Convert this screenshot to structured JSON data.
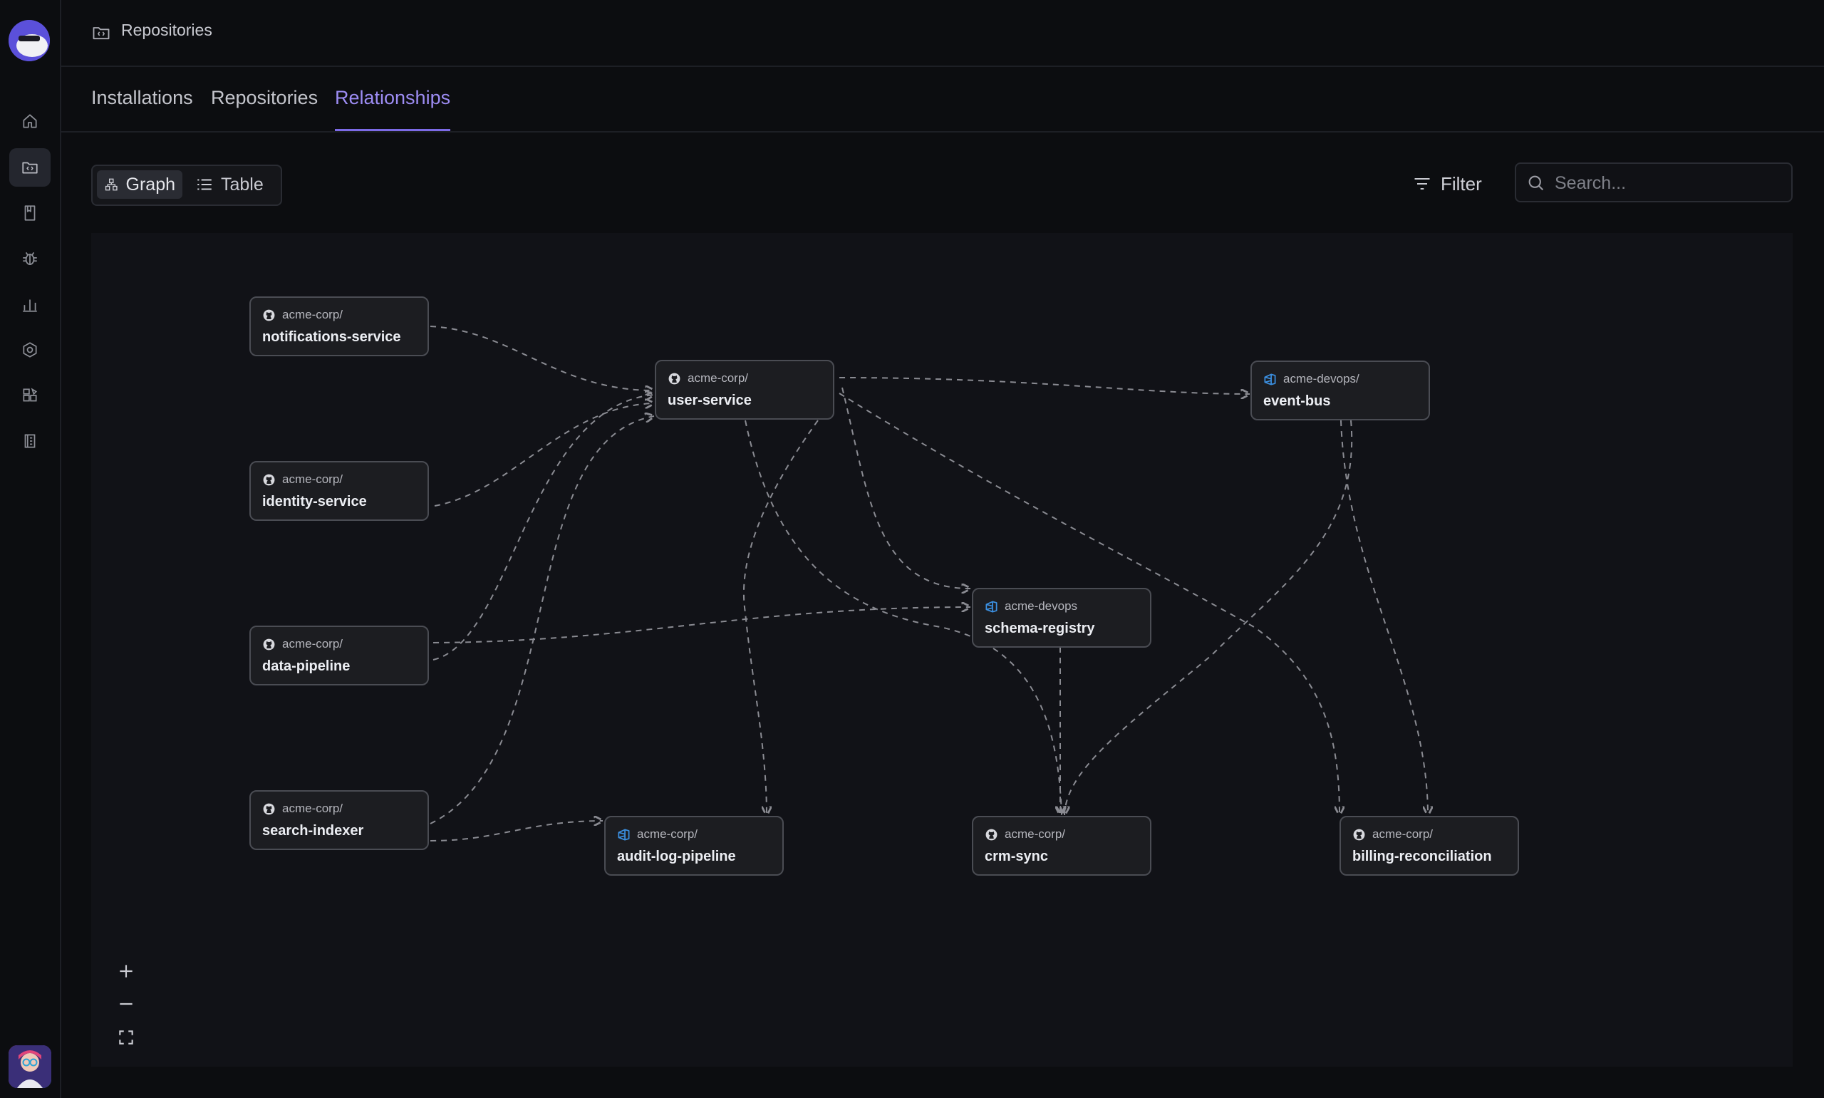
{
  "header": {
    "breadcrumb": "Repositories"
  },
  "tabs": [
    {
      "label": "Installations"
    },
    {
      "label": "Repositories"
    },
    {
      "label": "Relationships",
      "active": true
    }
  ],
  "view_toggle": {
    "graph_label": "Graph",
    "table_label": "Table",
    "active": "Graph"
  },
  "filter_label": "Filter",
  "search": {
    "placeholder": "Search...",
    "value": ""
  },
  "colors": {
    "accent": "#9d8cf3",
    "azure_icon": "#3b8fe0"
  },
  "nodes": [
    {
      "id": "notifications-service",
      "org": "acme-corp/",
      "name": "notifications-service",
      "icon": "github-icon"
    },
    {
      "id": "identity-service",
      "org": "acme-corp/",
      "name": "identity-service",
      "icon": "github-icon"
    },
    {
      "id": "data-pipeline",
      "org": "acme-corp/",
      "name": "data-pipeline",
      "icon": "github-icon"
    },
    {
      "id": "search-indexer",
      "org": "acme-corp/",
      "name": "search-indexer",
      "icon": "github-icon"
    },
    {
      "id": "user-service",
      "org": "acme-corp/",
      "name": "user-service",
      "icon": "github-icon"
    },
    {
      "id": "event-bus",
      "org": "acme-devops/",
      "name": "event-bus",
      "icon": "azure-devops-icon"
    },
    {
      "id": "schema-registry",
      "org": "acme-devops",
      "name": "schema-registry",
      "icon": "azure-devops-icon"
    },
    {
      "id": "audit-log-pipeline",
      "org": "acme-corp/",
      "name": "audit-log-pipeline",
      "icon": "azure-devops-icon"
    },
    {
      "id": "crm-sync",
      "org": "acme-corp/",
      "name": "crm-sync",
      "icon": "github-icon"
    },
    {
      "id": "billing-reconciliation",
      "org": "acme-corp/",
      "name": "billing-reconciliation",
      "icon": "github-icon"
    }
  ],
  "sidebar_icons": [
    "home-icon",
    "repositories-icon",
    "book-icon",
    "bug-icon",
    "chart-icon",
    "settings-icon",
    "integrations-icon",
    "reports-icon"
  ],
  "zoom_controls": [
    "zoom-in-icon",
    "zoom-out-icon",
    "fit-view-icon"
  ]
}
